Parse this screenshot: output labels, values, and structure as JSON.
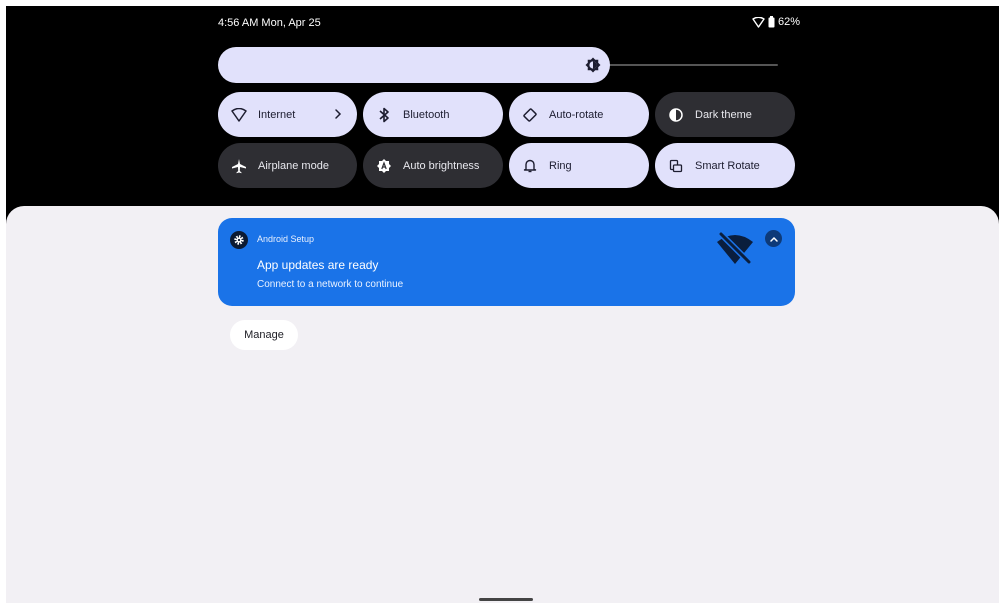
{
  "status_bar": {
    "time_date": "4:56 AM Mon, Apr 25",
    "battery": "62%"
  },
  "brightness": {
    "level": 0.7
  },
  "tiles": [
    {
      "id": "internet",
      "label": "Internet",
      "icon": "wifi-icon",
      "on": true,
      "has_chevron": true
    },
    {
      "id": "bluetooth",
      "label": "Bluetooth",
      "icon": "bluetooth-icon",
      "on": true
    },
    {
      "id": "auto-rotate",
      "label": "Auto-rotate",
      "icon": "auto-rotate-icon",
      "on": true
    },
    {
      "id": "dark-theme",
      "label": "Dark theme",
      "icon": "dark-theme-icon",
      "on": false
    },
    {
      "id": "airplane-mode",
      "label": "Airplane mode",
      "icon": "airplane-icon",
      "on": false
    },
    {
      "id": "auto-brightness",
      "label": "Auto brightness",
      "icon": "auto-brightness-icon",
      "on": false
    },
    {
      "id": "ring",
      "label": "Ring",
      "icon": "bell-icon",
      "on": true
    },
    {
      "id": "smart-rotate",
      "label": "Smart Rotate",
      "icon": "smart-rotate-icon",
      "on": true
    }
  ],
  "notification": {
    "app_name": "Android Setup",
    "title": "App updates are ready",
    "text": "Connect to a network to continue",
    "color": "#1a73e8"
  },
  "manage_label": "Manage"
}
